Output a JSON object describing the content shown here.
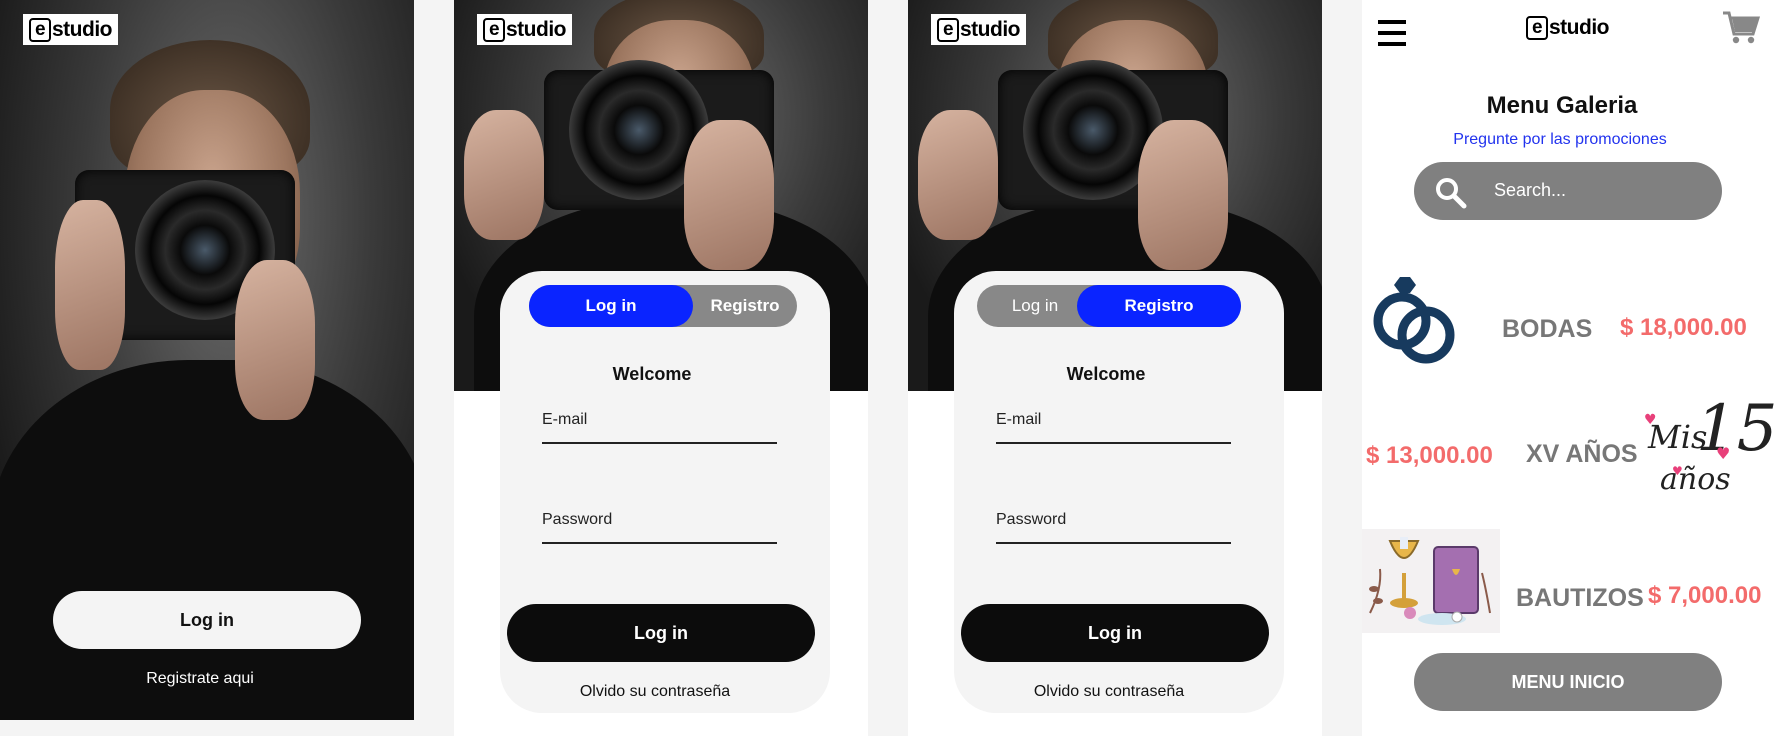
{
  "brand": {
    "logo_text": "studio",
    "logo_mark": "e"
  },
  "screen1": {
    "login_button": "Log in",
    "register_link": "Registrate aqui"
  },
  "screen2": {
    "tab_login": "Log in",
    "tab_register": "Registro",
    "active_tab": "login",
    "welcome": "Welcome",
    "email_label": "E-mail",
    "password_label": "Password",
    "submit_button": "Log in",
    "forgot_link": "Olvido su contraseña"
  },
  "screen3": {
    "tab_login": "Log in",
    "tab_register": "Registro",
    "active_tab": "register",
    "welcome": "Welcome",
    "email_label": "E-mail",
    "password_label": "Password",
    "submit_button": "Log in",
    "forgot_link": "Olvido su contraseña"
  },
  "gallery": {
    "menu_icon": "hamburger-icon",
    "cart_icon": "shopping-cart-icon",
    "title": "Menu Galeria",
    "subtitle": "Pregunte por las promociones",
    "search_placeholder": "Search...",
    "items": [
      {
        "name": "BODAS",
        "price": "$ 18,000.00",
        "icon": "wedding-rings-icon"
      },
      {
        "name": "XV AÑOS",
        "price": "$ 13,000.00",
        "icon": "mis-15-anos-icon",
        "icon_text_top": "Mis",
        "icon_text_num": "15",
        "icon_text_bottom": "años"
      },
      {
        "name": "BAUTIZOS",
        "price": "$ 7,000.00",
        "icon": "baptism-chalice-bible-icon"
      }
    ],
    "home_button": "MENU INICIO"
  },
  "colors": {
    "accent_blue": "#0a24ff",
    "toggle_gray": "#888888",
    "price_red": "#f36b6b",
    "search_gray": "#808080",
    "button_black": "#0c0c0c"
  }
}
